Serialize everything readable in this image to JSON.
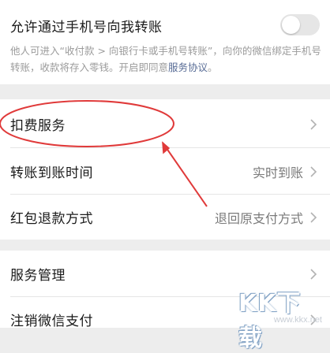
{
  "phone_transfer": {
    "title": "允许通过手机号向我转账",
    "toggle_state": "off",
    "description": "他人可进入“收付款 > 向银行卡或手机号转账”，向你的微信绑定手机号转账，收款将存入零钱。开启即同意",
    "agreement_link": "服务协议",
    "description_end": "。"
  },
  "settings": {
    "deduction": {
      "label": "扣费服务"
    },
    "arrival_time": {
      "label": "转账到账时间",
      "value": "实时到账"
    },
    "refund_method": {
      "label": "红包退款方式",
      "value": "退回原支付方式"
    }
  },
  "more": {
    "service_manage": {
      "label": "服务管理"
    },
    "cancel_pay": {
      "label": "注销微信支付"
    }
  },
  "watermark": {
    "logo": "KK下载",
    "url": "www.kkx.net"
  },
  "colors": {
    "annotation_red": "#e03a3a",
    "link_blue": "#576b95"
  }
}
